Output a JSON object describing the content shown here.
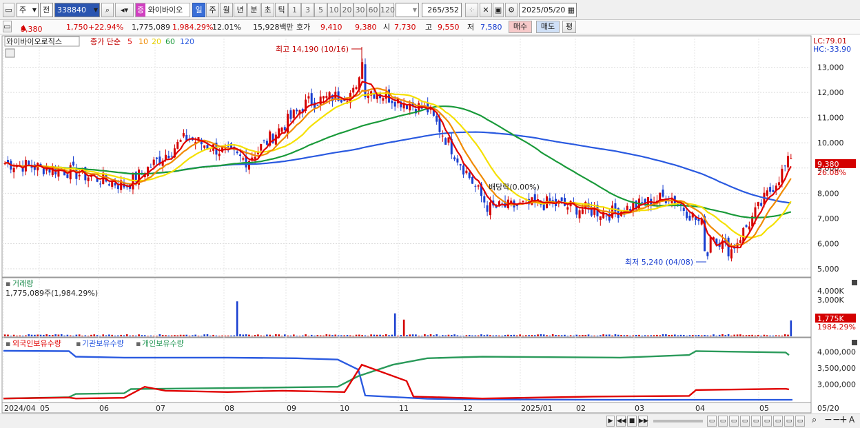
{
  "toolbar": {
    "market_label": "주",
    "prefix_label": "전",
    "code_value": "338840",
    "stock_badge": "증",
    "stock_name": "와이바이오",
    "periods": [
      "일",
      "주",
      "월",
      "년",
      "분",
      "초",
      "틱"
    ],
    "active_period": "일",
    "intervals": [
      "1",
      "3",
      "5",
      "10",
      "20",
      "30",
      "60",
      "120"
    ],
    "count_value": "265",
    "count_total": "/352",
    "date_value": "2025/05/20"
  },
  "quote": {
    "price": "9,380",
    "change": "1,750",
    "change_pct": "+22.94%",
    "volume": "1,775,089",
    "volume_pct": "1,984.29%",
    "turnover": "12.01%",
    "amount": "15,928백만",
    "bid_label": "호가",
    "bid_value": "9,410",
    "ask_value": "9,380",
    "open_label": "시",
    "open_value": "7,730",
    "high_label": "고",
    "high_value": "9,550",
    "low_label": "저",
    "low_value": "7,580",
    "buy_button": "매수",
    "sell_button": "매도",
    "eval_button": "평"
  },
  "price_pane": {
    "legend_name": "와이바이오로직스",
    "ma_label": "종가 단순",
    "ma_periods": [
      "5",
      "10",
      "20",
      "60",
      "120"
    ],
    "lc": "LC:79.01",
    "hc": "HC:-33.90",
    "y_ticks": [
      "13,000",
      "12,000",
      "11,000",
      "10,000",
      "9,000",
      "8,000",
      "7,000",
      "6,000",
      "5,000"
    ],
    "high_annotation": "최고 14,190 (10/16)",
    "low_annotation": "최저 5,240 (04/08)",
    "dividend_annotation": "배당락(0.00%)",
    "current_price_tag": "9,380",
    "current_pct_tag": "26.08%"
  },
  "volume_pane": {
    "title": "거래량",
    "value_text": "1,775,089주(1,984.29%)",
    "y_ticks": [
      "4,000K",
      "3,000K"
    ],
    "current_tag": "1,775K",
    "current_pct": "1984.29%"
  },
  "holdings_pane": {
    "legends": [
      "외국인보유수량",
      "기관보유수량",
      "개인보유수량"
    ],
    "y_ticks": [
      "4,000,000",
      "3,500,000",
      "3,000,000"
    ]
  },
  "x_axis": {
    "labels": [
      "2024/04",
      "05",
      "06",
      "07",
      "08",
      "09",
      "10",
      "11",
      "12",
      "2025/01",
      "02",
      "03",
      "04",
      "05"
    ],
    "right_label": "05/20"
  },
  "colors": {
    "up": "#d40000",
    "down": "#1a3fd0",
    "ma5": "#e00000",
    "ma10": "#f08a00",
    "ma20": "#f5e000",
    "ma60": "#1a9a3a",
    "ma120": "#2a5ae0",
    "foreign": "#e00000",
    "institution": "#2a5ae0",
    "individual": "#2a9a5a"
  },
  "chart_data": {
    "type": "candlestick",
    "x": [
      "2024/04",
      "05",
      "06",
      "07",
      "08",
      "09",
      "10",
      "11",
      "12",
      "2025/01",
      "02",
      "03",
      "04",
      "05"
    ],
    "close_anchor": [
      9200,
      8900,
      8300,
      10200,
      9300,
      11600,
      12100,
      11300,
      7400,
      7600,
      7200,
      7900,
      5700,
      9380
    ],
    "high_point": {
      "date": "10/16",
      "value": 14190
    },
    "low_point": {
      "date": "04/08",
      "value": 5240
    },
    "ylim": [
      5000,
      14000
    ],
    "last_close": 9380
  }
}
